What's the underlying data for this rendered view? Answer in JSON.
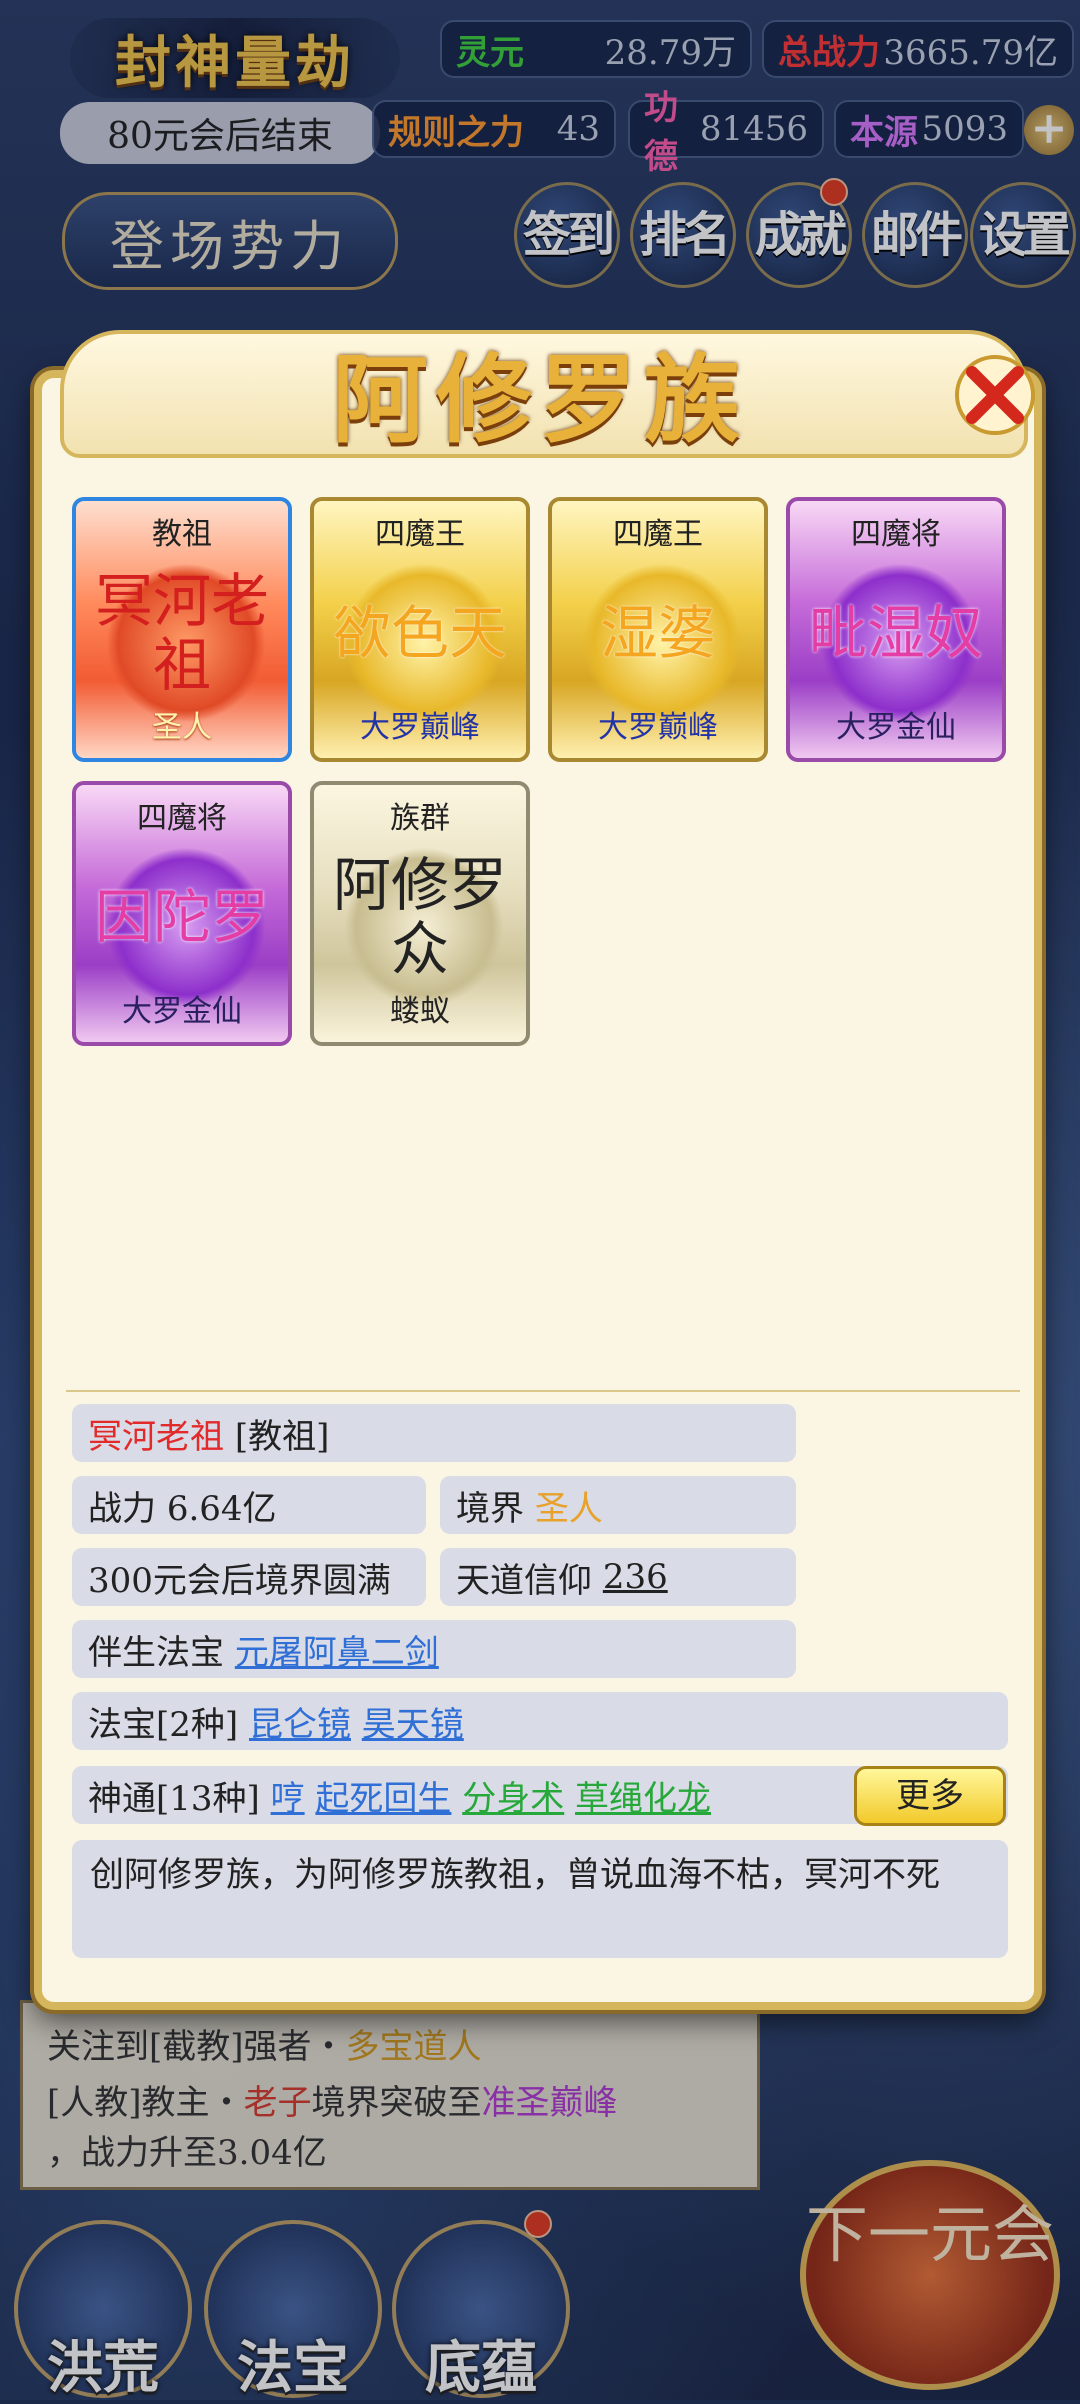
{
  "hud": {
    "title": "封神量劫",
    "timer": "80元会后结束",
    "stats": {
      "lingyuan_label": "灵元",
      "lingyuan_value": "28.79万",
      "power_label": "总战力",
      "power_value": "3665.79亿",
      "rule_label": "规则之力",
      "rule_value": "43",
      "merit_label": "功德",
      "merit_value": "81456",
      "origin_label": "本源",
      "origin_value": "5093"
    },
    "power_button": "登场势力",
    "buttons": [
      "签到",
      "排名",
      "成就",
      "邮件",
      "设置"
    ]
  },
  "popup": {
    "title": "阿修罗族",
    "cards": [
      {
        "rank": "教祖",
        "name": "冥河老祖",
        "realm": "圣人",
        "style": "red"
      },
      {
        "rank": "四魔王",
        "name": "欲色天",
        "realm": "大罗巅峰",
        "style": "gold"
      },
      {
        "rank": "四魔王",
        "name": "湿婆",
        "realm": "大罗巅峰",
        "style": "gold"
      },
      {
        "rank": "四魔将",
        "name": "毗湿奴",
        "realm": "大罗金仙",
        "style": "purple"
      },
      {
        "rank": "四魔将",
        "name": "因陀罗",
        "realm": "大罗金仙",
        "style": "purple"
      },
      {
        "rank": "族群",
        "name": "阿修罗众",
        "realm": "蝼蚁",
        "style": "white"
      }
    ],
    "detail": {
      "name": "冥河老祖",
      "rank": "[教祖]",
      "power_label": "战力",
      "power_value": "6.64亿",
      "realm_label": "境界",
      "realm_value": "圣人",
      "perfection": "300元会后境界圆满",
      "faith_label": "天道信仰",
      "faith_value": "236",
      "companion_label": "伴生法宝",
      "companion_value": "元屠阿鼻二剑",
      "treasures_label": "法宝[2种]",
      "treasures": [
        "昆仑镜",
        "昊天镜"
      ],
      "abilities_label": "神通[13种]",
      "abilities": [
        "哼",
        "起死回生",
        "分身术",
        "草绳化龙"
      ],
      "more_button": "更多",
      "description": "创阿修罗族，为阿修罗族教祖，曾说血海不枯，冥河不死"
    }
  },
  "background": {
    "news_line1_a": "关注到[截教]强者・",
    "news_line1_b": "多宝道人",
    "news_line2_a": "[人教]教主・",
    "news_line2_b": "老子",
    "news_line2_c": "境界突破至",
    "news_line2_d": "准圣巅峰",
    "news_line3": "，战力升至3.04亿",
    "next_button": "下一元会",
    "nav": [
      "洪荒",
      "法宝",
      "底蕴"
    ]
  }
}
